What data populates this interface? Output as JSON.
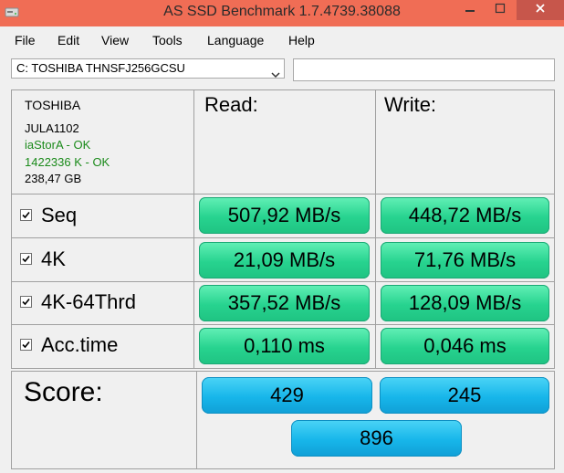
{
  "window": {
    "title": "AS SSD Benchmark 1.7.4739.38088"
  },
  "menu": [
    "File",
    "Edit",
    "View",
    "Tools",
    "Language",
    "Help"
  ],
  "drive_select": {
    "value": "C: TOSHIBA THNSFJ256GCSU"
  },
  "drive_info": {
    "vendor": "TOSHIBA",
    "firmware": "JULA1102",
    "driver": "iaStorA - OK",
    "alignment": "1422336 K - OK",
    "size": "238,47 GB"
  },
  "columns": {
    "read": "Read:",
    "write": "Write:"
  },
  "rows": [
    {
      "label": "Seq",
      "checked": true,
      "read": "507,92 MB/s",
      "write": "448,72 MB/s"
    },
    {
      "label": "4K",
      "checked": true,
      "read": "21,09 MB/s",
      "write": "71,76 MB/s"
    },
    {
      "label": "4K-64Thrd",
      "checked": true,
      "read": "357,52 MB/s",
      "write": "128,09 MB/s"
    },
    {
      "label": "Acc.time",
      "checked": true,
      "read": "0,110 ms",
      "write": "0,046 ms"
    }
  ],
  "score": {
    "label": "Score:",
    "read": "429",
    "write": "245",
    "total": "896"
  },
  "colors": {
    "titlebar": "#f06d55",
    "result_cell": "#27d38f",
    "score_cell": "#17b6ea",
    "ok_text": "#1a8a1a"
  },
  "icons": {
    "app": "drive-icon",
    "minimize": "minimize-icon",
    "maximize": "maximize-icon",
    "close": "close-icon",
    "dropdown": "chevron-down-icon",
    "checkbox": "checkmark-icon"
  }
}
